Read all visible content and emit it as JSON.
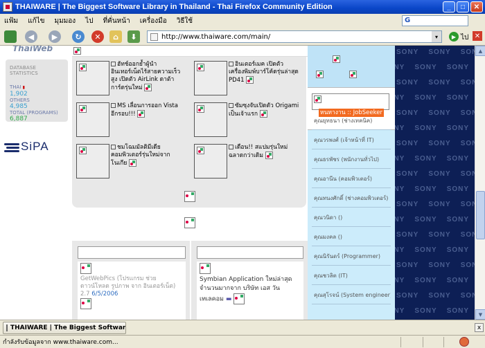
{
  "window": {
    "title": "THAIWARE | The Biggest Software Library in Thailand - Thai Firefox Community Edition",
    "minimize": "_",
    "maximize": "□",
    "close": "✕"
  },
  "menu": [
    "แฟ้ม",
    "แก้ไข",
    "มุมมอง",
    "ไป",
    "ที่คั่นหน้า",
    "เครื่องมือ",
    "วิธีใช้"
  ],
  "search": {
    "engine_glyph": "G"
  },
  "toolbar": {
    "url": "http://www.thaiware.com/main/",
    "go_label": "ไป",
    "url_dropdown": "▾"
  },
  "left": {
    "logo_fragment": "ThaiWeb",
    "stats_header": "DATABASE STATISTICS",
    "thai_label": "THAI",
    "thai_value": "1,902",
    "others_label": "OTHERS",
    "others_value": "4,985",
    "total_label": "TOTAL (PROGRAMS)",
    "total_value": "6,887",
    "sipa": "SiPA"
  },
  "news": [
    {
      "text": "ฮัทช์ออกย้ำผู้นำอินเทอร์เน็ตไร้สายความเร็วสูง เปิดตัว AirLink ดาต้าการ์ดรุ่นใหม่"
    },
    {
      "text": "อินเตอร์เมค เปิดตัวเครื่องพิมพ์บาร์โค้ดรุ่นล่าสุด PD41"
    },
    {
      "text": "MS เลื่อนการออก Vista อีกรอบ!!!"
    },
    {
      "text": "ซัมซุงจับเปิดตัว Origami เป็นเจ้าแรก"
    },
    {
      "text": "ชมโฉมมัลติมีเดียคอมพิวเตอร์รุ่นใหม่จากโนเกีย"
    },
    {
      "text": "เดือน!! สแปมรุ่นใหม่ ฉลาดกว่าเดิม"
    }
  ],
  "cards": {
    "left_text": "GetWebPics (โปรแกรม ช่วยดาวน์โหลด รูปภาพ จาก อินเตอร์เน็ต)",
    "left_version": "2.7",
    "left_date": "6/5/2006",
    "right_text": "Symbian Application ใหม่ล่าสุดจำนวนมากจาก บริษัท เอส วันเทเลคอม"
  },
  "jobs": {
    "title": "หนทางาน :: JobSeeker",
    "items": [
      "คุณยุทธนา (ช่างเทคนิค)",
      "คุณวรพงศ์ (เจ้าหน้าที่ IT)",
      "คุณธรพัชร (พนักงานทั่วไป)",
      "คุณอานีน (คอมพิวเตอร์)",
      "คุณทนงศักดิ์ (ช่างคอมพิวเตอร์)",
      "คุณวนิดา ()",
      "คุณมงคล ()",
      "คุณนิรันดร์ (Programmer)",
      "คุณชวลิต (IT)",
      "คุณสุโรจน์ (System engineer)"
    ]
  },
  "sony": {
    "word": "SONY"
  },
  "taskbar": {
    "item": "THAIWARE | The Biggest Software Li...",
    "close": "x"
  },
  "status": {
    "text": "กำลังรับข้อมูลจาก www.thaiware.com..."
  }
}
